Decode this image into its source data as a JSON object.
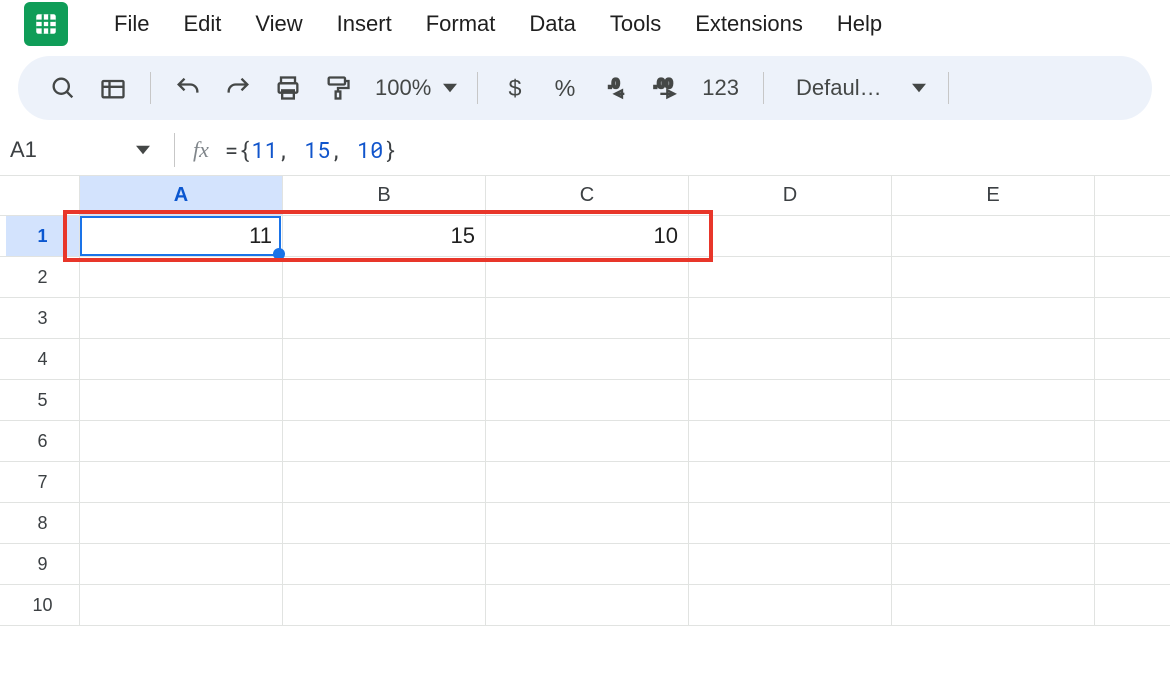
{
  "menu": [
    "File",
    "Edit",
    "View",
    "Insert",
    "Format",
    "Data",
    "Tools",
    "Extensions",
    "Help"
  ],
  "toolbar": {
    "zoom": "100%",
    "number_format": "123",
    "font": "Defaul…"
  },
  "namebox": {
    "ref": "A1"
  },
  "formula": {
    "prefix": "={",
    "n1": "11",
    "n2": "15",
    "n3": "10",
    "suffix": "}"
  },
  "columns": [
    "A",
    "B",
    "C",
    "D",
    "E"
  ],
  "rows": [
    "1",
    "2",
    "3",
    "4",
    "5",
    "6",
    "7",
    "8",
    "9",
    "10"
  ],
  "cells": {
    "A1": "11",
    "B1": "15",
    "C1": "10"
  },
  "active_col_index": 0,
  "active_row_index": 0
}
